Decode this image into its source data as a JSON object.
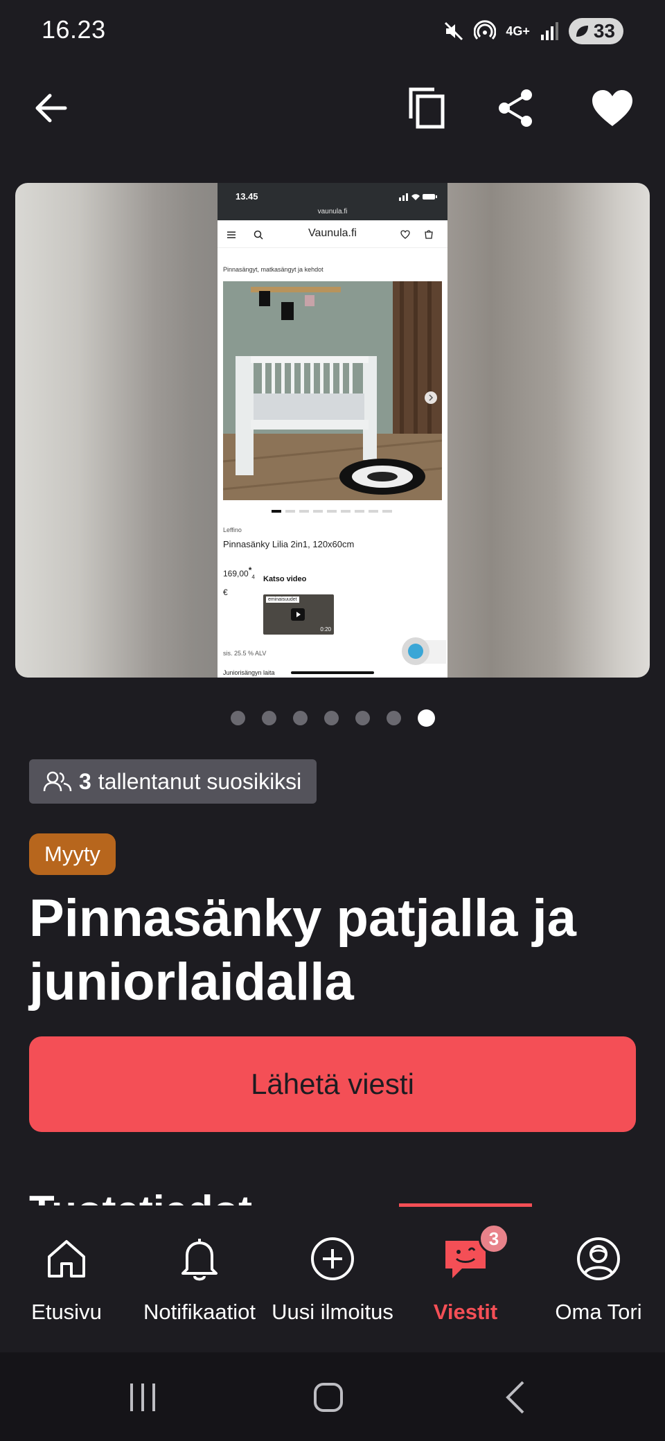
{
  "status_bar": {
    "time": "16.23",
    "battery": "33",
    "network": "4G+"
  },
  "top_bar": {
    "back_icon": "arrow-left-icon",
    "copy_icon": "copy-icon",
    "share_icon": "share-icon",
    "favorite_icon": "heart-icon"
  },
  "gallery": {
    "screenshot": {
      "time": "13.45",
      "url": "vaunula.fi",
      "site_name": "Vaunula.fi",
      "breadcrumb": "Pinnasängyt, matkasängyt ja kehdot",
      "brand": "Leffino",
      "product_name": "Pinnasänky Lilia 2in1, 120x60cm",
      "price": "169,00",
      "price_superscript": "*",
      "price_subscript": "4",
      "currency": "€",
      "video_title": "Katso video",
      "video_caption": "eminaisuudet",
      "video_duration": "0:20",
      "vat": "sis. 25.5 % ALV",
      "junior_text": "Juniorisängyn laita"
    },
    "page_count": 7,
    "active_page": 7
  },
  "listing": {
    "favorite_count": "3",
    "favorite_text": "tallentanut suosikiksi",
    "status_badge": "Myyty",
    "title": "Pinnasänky patjalla ja juniorlaidalla",
    "send_message": "Lähetä viesti",
    "section_peek": "Tuotetiedot"
  },
  "bottom_nav": {
    "items": [
      {
        "label": "Etusivu",
        "icon": "home-icon"
      },
      {
        "label": "Notifikaatiot",
        "icon": "bell-icon"
      },
      {
        "label": "Uusi ilmoitus",
        "icon": "plus-circle-icon"
      },
      {
        "label": "Viestit",
        "icon": "chat-icon",
        "badge": "3",
        "active": true
      },
      {
        "label": "Oma Tori",
        "icon": "profile-icon"
      }
    ]
  },
  "colors": {
    "background": "#1d1c21",
    "accent": "#f44f56",
    "sold_badge": "#b7661d",
    "fav_chip": "#54535b"
  }
}
